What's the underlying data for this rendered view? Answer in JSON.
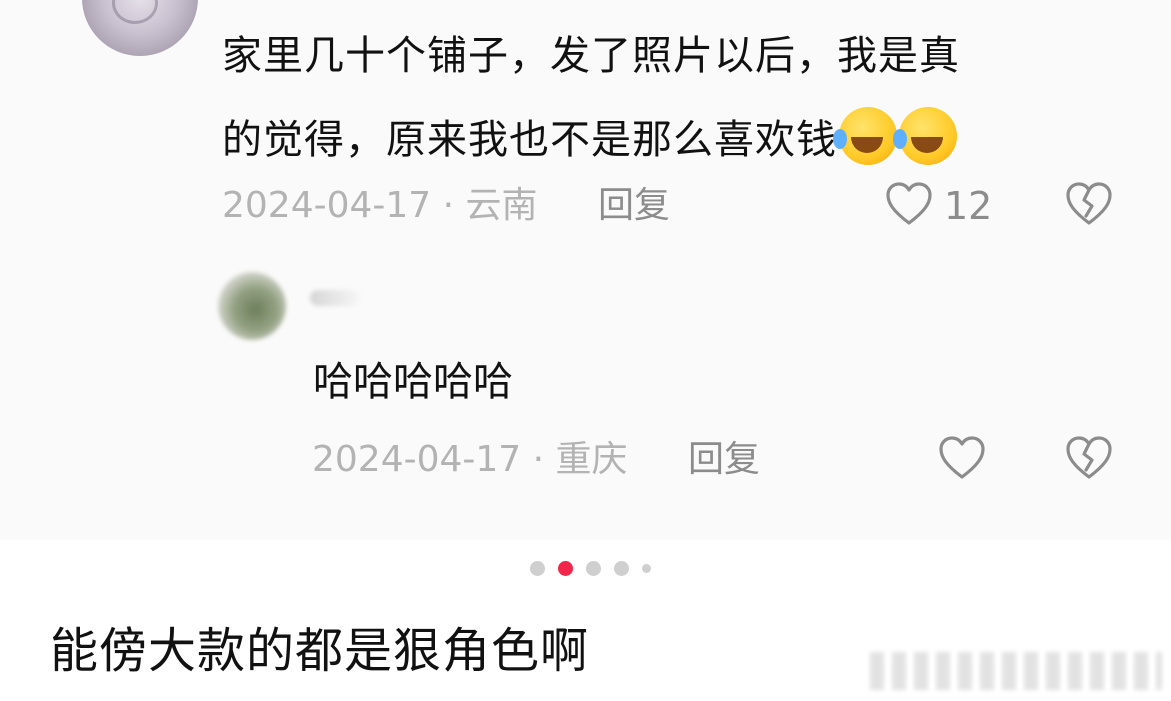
{
  "comment": {
    "text_line1": "家里几十个铺子，发了照片以后，我是真",
    "text_line2": "的觉得，原来我也不是那么喜欢钱",
    "emojis": [
      "laughing-crying-emoji",
      "laughing-crying-emoji"
    ],
    "date_location": "2024-04-17 · 云南",
    "reply_label": "回复",
    "like_count": "12"
  },
  "reply": {
    "text": "哈哈哈哈哈",
    "date_location": "2024-04-17 · 重庆",
    "reply_label": "回复"
  },
  "pager": {
    "total": 5,
    "active_index": 1
  },
  "post": {
    "caption": "能傍大款的都是狠角色啊"
  },
  "colors": {
    "accent": "#f2264a",
    "meta_text": "#b3b3b3",
    "action_text": "#8c8c8c",
    "body_text": "#111111",
    "card_bg": "#fafafa"
  },
  "icons": {
    "like": "heart-outline-icon",
    "dislike": "broken-heart-icon"
  }
}
